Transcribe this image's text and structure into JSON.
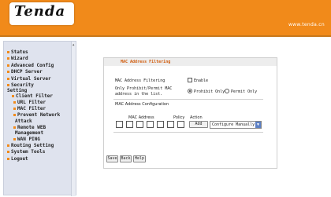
{
  "header": {
    "logo_text": "Tenda",
    "site_text": "www.tenda.cn"
  },
  "sidebar": {
    "items": [
      {
        "label": "Status",
        "bullet": true
      },
      {
        "label": "Wizard",
        "bullet": true
      },
      {
        "label": "Advanced Config",
        "bullet": true
      },
      {
        "label": "DHCP Server",
        "bullet": true
      },
      {
        "label": "Virtual Server",
        "bullet": true
      },
      {
        "label": "Security",
        "bullet": true
      },
      {
        "label": "Setting",
        "bullet": false
      },
      {
        "label": "Client Filter",
        "bullet": true
      },
      {
        "label": "URL Filter",
        "bullet": true
      },
      {
        "label": "MAC Filter",
        "bullet": true
      },
      {
        "label": "Prevent Network",
        "bullet": true
      },
      {
        "label": "Attack",
        "bullet": false
      },
      {
        "label": "Remote WEB",
        "bullet": true
      },
      {
        "label": "Management",
        "bullet": false
      },
      {
        "label": "WAN PING",
        "bullet": true
      },
      {
        "label": "Routing Setting",
        "bullet": true
      },
      {
        "label": "System Tools",
        "bullet": true
      },
      {
        "label": "Logout",
        "bullet": true
      }
    ]
  },
  "main": {
    "title": "MAC Address Filtering",
    "filtering_label": "MAC Address Filtering",
    "enable_label": "Enable",
    "only_label_1": "Only Prohibit/Permit MAC",
    "only_label_2": "address in the list.",
    "prohibit_label": "Prohibit Only",
    "permit_label": "Permit Only",
    "config_heading": "MAC Address Configuration",
    "col_mac": "MAC Address",
    "col_policy": "Policy",
    "col_action": "Action",
    "add_button": "Add",
    "policy_selected": "Configure Manually",
    "buttons": {
      "save": "Save",
      "back": "Back",
      "help": "Help"
    }
  },
  "colors": {
    "header": "#f18a1a",
    "title": "#d05a0a",
    "sidebar_bg": "#dfe3ee"
  }
}
